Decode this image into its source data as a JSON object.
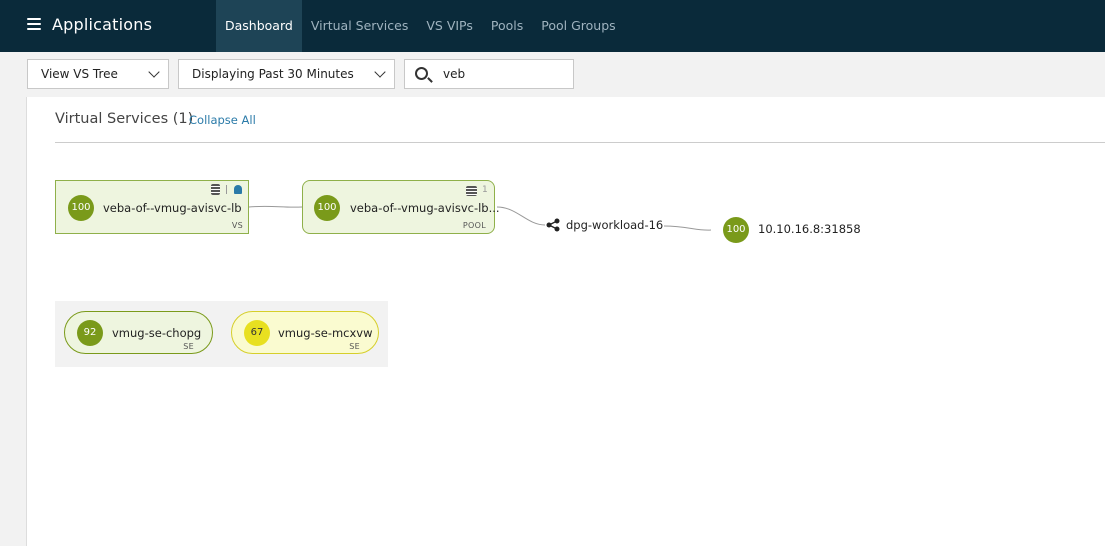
{
  "header": {
    "title": "Applications",
    "tabs": [
      {
        "label": "Dashboard",
        "active": true
      },
      {
        "label": "Virtual Services",
        "active": false
      },
      {
        "label": "VS VIPs",
        "active": false
      },
      {
        "label": "Pools",
        "active": false
      },
      {
        "label": "Pool Groups",
        "active": false
      }
    ]
  },
  "toolbar": {
    "view_select": "View VS Tree",
    "time_select": "Displaying Past 30 Minutes",
    "search_value": "veb"
  },
  "main": {
    "heading": "Virtual Services (1)",
    "collapse_label": "Collapse All",
    "vs_node": {
      "score": "100",
      "name": "veba-of--vmug-avisvc-lb",
      "tag": "VS"
    },
    "pool_node": {
      "score": "100",
      "name": "veba-of--vmug-avisvc-lb...",
      "tag": "POOL",
      "count": "1"
    },
    "network": {
      "name": "dpg-workload-16"
    },
    "server": {
      "score": "100",
      "address": "10.10.16.8:31858"
    },
    "service_engines": [
      {
        "score": "92",
        "name": "vmug-se-chopg",
        "tag": "SE",
        "color": "#7a9a1a"
      },
      {
        "score": "67",
        "name": "vmug-se-mcxvw",
        "tag": "SE",
        "color": "#e8e020"
      }
    ]
  },
  "colors": {
    "topbar": "#0a2a3a",
    "active_tab": "#1e4456",
    "healthy": "#7a9a1a",
    "warning": "#e8e020",
    "link": "#2a7aa8"
  }
}
